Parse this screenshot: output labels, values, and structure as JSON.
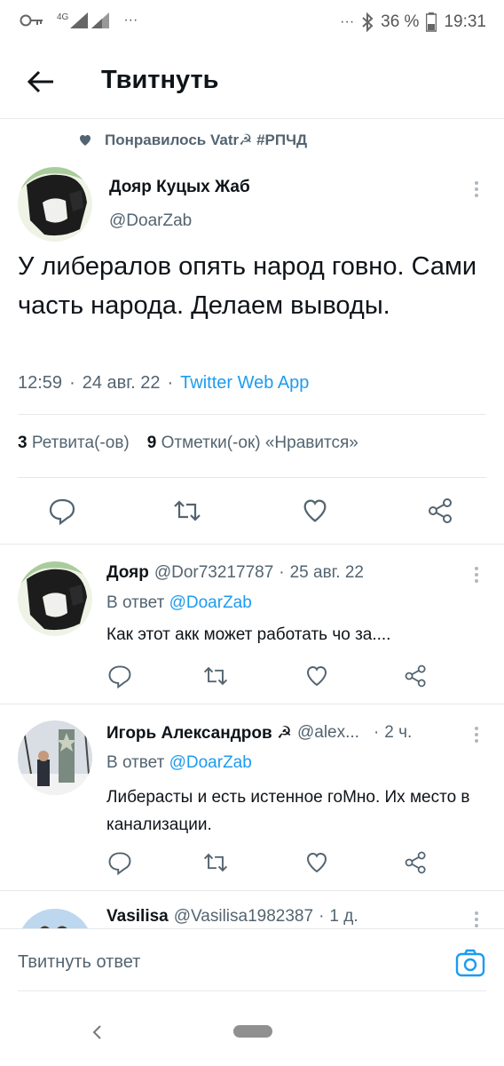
{
  "status_bar": {
    "network": "4G",
    "dots_left": "···",
    "dots_right": "···",
    "battery": "36 %",
    "time": "19:31"
  },
  "header": {
    "title": "Твитнуть"
  },
  "liked_by": "Понравилось Vatr☭ #РПЧД",
  "tweet": {
    "author_name": "Дояр Куцых Жаб",
    "author_handle": "@DoarZab",
    "text": "У либералов опять народ говно. Сами часть народа. Делаем выводы.",
    "time": "12:59",
    "date": "24 авг. 22",
    "separator": "·",
    "client": "Twitter Web App",
    "retweets_count": "3",
    "retweets_label": "Ретвита(-ов)",
    "likes_count": "9",
    "likes_label": "Отметки(-ок) «Нравится»"
  },
  "replies": [
    {
      "name": "Дояр",
      "handle": "@Dor73217787",
      "separator": "·",
      "time": "25 авг. 22",
      "reply_prefix": "В ответ",
      "reply_to": "@DoarZab",
      "text": "Как этот акк может работать чо за...."
    },
    {
      "name": "Игорь Александров ☭",
      "handle": "@alex...",
      "separator": "·",
      "time": "2 ч.",
      "reply_prefix": "В ответ",
      "reply_to": "@DoarZab",
      "text": "Либерасты и есть истенное гоМно. Их место в канализации."
    },
    {
      "name": "Vasilisa",
      "handle": "@Vasilisa1982387",
      "separator": "·",
      "time": "1 д."
    }
  ],
  "reply_box": {
    "placeholder": "Твитнуть ответ"
  },
  "icons": {
    "back": "arrow-left-icon",
    "heart": "heart-icon",
    "reply": "reply-icon",
    "retweet": "retweet-icon",
    "share": "share-icon",
    "camera": "camera-icon"
  },
  "colors": {
    "accent": "#1d9bf0",
    "muted": "#536471"
  }
}
